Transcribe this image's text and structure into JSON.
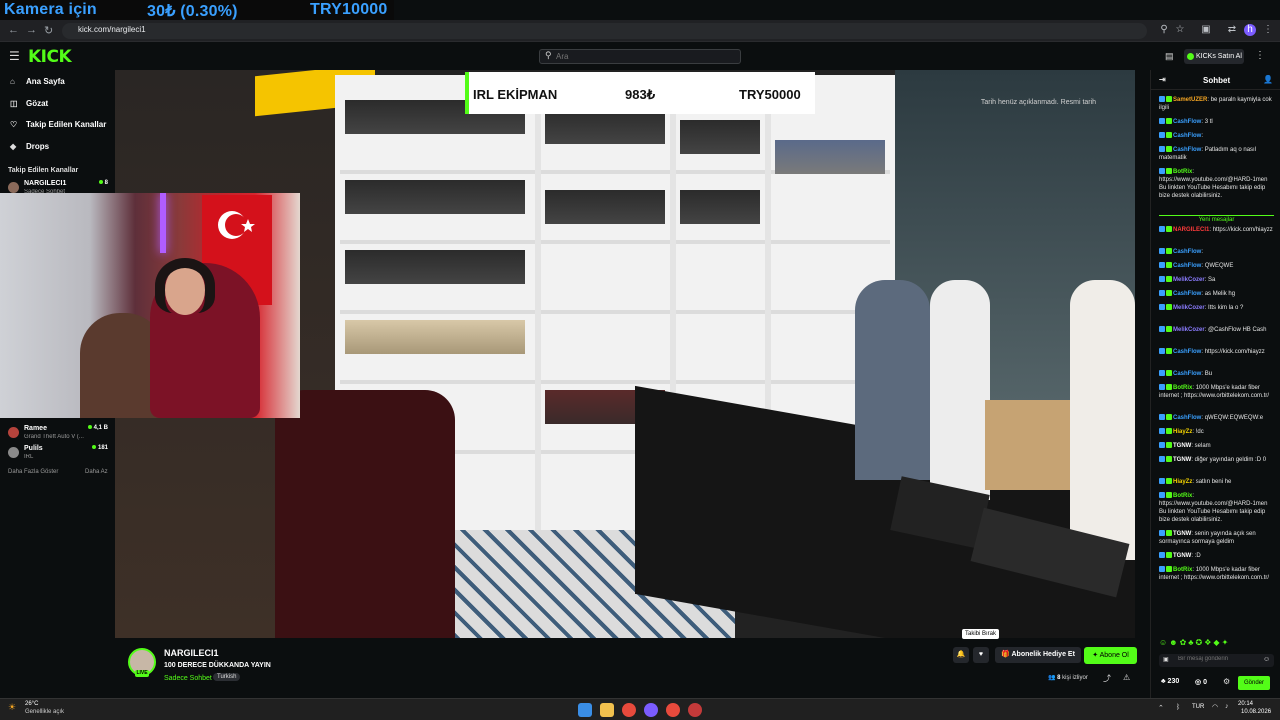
{
  "overlay_top": {
    "left": "Kamera için",
    "mid": "30₺ (0.30%)",
    "right": "TRY10000"
  },
  "browser": {
    "url": "kick.com/nargileci1"
  },
  "header": {
    "logo": "KICK",
    "search_placeholder": "Ara",
    "buy_label": "KICKs Satın Al"
  },
  "sidebar": {
    "nav": [
      {
        "label": "Ana Sayfa",
        "icon": "home-icon"
      },
      {
        "label": "Gözat",
        "icon": "browse-icon"
      },
      {
        "label": "Takip Edilen Kanallar",
        "icon": "heart-icon"
      },
      {
        "label": "Drops",
        "icon": "drops-icon"
      }
    ],
    "followed_title": "Takip Edilen Kanallar",
    "channels": [
      {
        "name": "NARGILECI1",
        "game": "Sadece Sohbet",
        "viewers": "8"
      },
      {
        "name": "Ramee",
        "game": "Grand Theft Auto V (...",
        "viewers": "4,1 B"
      },
      {
        "name": "Pulils",
        "game": "IRL",
        "viewers": "181"
      }
    ],
    "show_more": "Daha Fazla Göster",
    "show_less": "Daha Az"
  },
  "video_overlay": {
    "label": "IRL EKİPMAN",
    "amount": "983₺",
    "target": "TRY50000",
    "note": "Tarih henüz açıklanmadı. Resmi tarih"
  },
  "stream": {
    "name": "NARGILECI1",
    "title": "100 DERECE DÜKKANDA YAYIN",
    "category": "Sadece Sohbet",
    "tag": "Turkish",
    "tooltip": "Takibi Bırak",
    "gift_label": "Abonelik Hediye Et",
    "sub_label": "Abone Ol",
    "viewers": "8",
    "viewers_label": "kişi izliyor",
    "live": "LIVE"
  },
  "chat": {
    "title": "Sohbet",
    "messages": [
      {
        "user": "SametUZER",
        "text": "be paraln kaymiyla cok ilgili",
        "color": "#f5a623"
      },
      {
        "user": "CashFlow",
        "text": "3 tl",
        "color": "#3aa0ff"
      },
      {
        "user": "CashFlow",
        "text": "",
        "color": "#3aa0ff"
      },
      {
        "user": "CashFlow",
        "text": "Patladım aq o nasıl matematik",
        "color": "#3aa0ff"
      },
      {
        "user": "BotRix",
        "text": "https://www.youtube.com/@HARD-1men Bu linkten YouTube Hesabımı takip edip bize destek olabilirsiniz.",
        "color": "#53fc18"
      }
    ],
    "new_messages": "Yeni mesajlar",
    "messages2": [
      {
        "user": "NARGILECI1",
        "text": "https://kick.com/hiayzz",
        "color": "#ff3b3b"
      },
      {
        "user": "CashFlow",
        "text": "",
        "color": "#3aa0ff"
      },
      {
        "user": "CashFlow",
        "text": "QWEQWE",
        "color": "#3aa0ff"
      },
      {
        "user": "MelikCozer",
        "text": "Sa",
        "color": "#8b7cff"
      },
      {
        "user": "CashFlow",
        "text": "as Melik hg",
        "color": "#3aa0ff"
      },
      {
        "user": "MelikCozer",
        "text": "Itts kim la o ?",
        "color": "#8b7cff"
      },
      {
        "user": "MelikCozer",
        "text": "@CashFlow HB Cash",
        "color": "#8b7cff"
      },
      {
        "user": "CashFlow",
        "text": "https://kick.com/hiayzz",
        "color": "#3aa0ff"
      },
      {
        "user": "CashFlow",
        "text": "Bu",
        "color": "#3aa0ff"
      },
      {
        "user": "BotRix",
        "text": "1000 Mbps'e kadar fiber internet ; https://www.orbittelekom.com.tr/",
        "color": "#53fc18"
      },
      {
        "user": "CashFlow",
        "text": "qWEQW:EQWEQW:e",
        "color": "#3aa0ff"
      },
      {
        "user": "HiayZz",
        "text": "!dc",
        "color": "#f5d400"
      },
      {
        "user": "TGNW",
        "text": "selam",
        "color": "#ffffff"
      },
      {
        "user": "TGNW",
        "text": "diğer yayından geldim :D 0",
        "color": "#ffffff"
      },
      {
        "user": "HiayZz",
        "text": "satlın beni he",
        "color": "#f5d400"
      },
      {
        "user": "BotRix",
        "text": "https://www.youtube.com/@HARD-1men Bu linkten YouTube Hesabımı takip edip bize destek olabilirsiniz.",
        "color": "#53fc18"
      },
      {
        "user": "TGNW",
        "text": "senin yayında açık sen sormayınca sormaya geldim",
        "color": "#ffffff"
      },
      {
        "user": "TGNW",
        "text": ":D",
        "color": "#ffffff"
      },
      {
        "user": "BotRix",
        "text": "1000 Mbps'e kadar fiber internet ; https://www.orbittelekom.com.tr/",
        "color": "#53fc18"
      }
    ],
    "input_placeholder": "Bir mesaj gönderin",
    "kicks": "230",
    "points": "0",
    "send": "Gönder"
  },
  "taskbar": {
    "weather_temp": "26°C",
    "weather_text": "Genellikle açık",
    "lang": "TUR",
    "time": "20:14",
    "date": "10.08.2026"
  }
}
